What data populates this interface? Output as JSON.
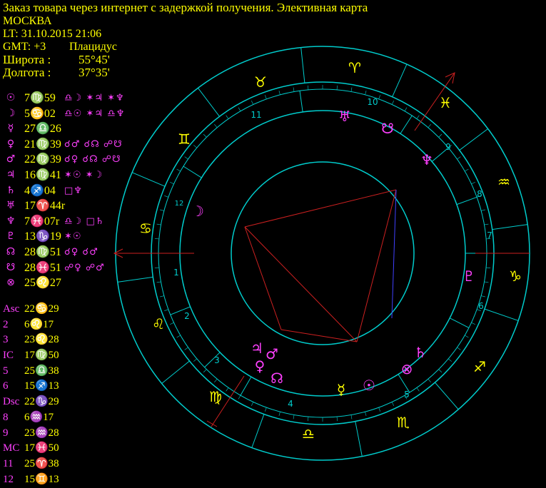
{
  "header": {
    "title": "Заказ товара через интернет с задержкой получения. Элективная карта",
    "city": "МОСКВА",
    "lt": "LT: 31.10.2015  21:06",
    "gmt": "GMT: +3",
    "house_system": "Плацидус",
    "lat_label": "Широта :",
    "lat_value": "55°45'",
    "lon_label": "Долгота :",
    "lon_value": "37°35'"
  },
  "planets": [
    {
      "glyph": "☉",
      "pos": "7♍59",
      "aspects": "♎☽ ✶♃ ✶♆"
    },
    {
      "glyph": "☽",
      "pos": "5♋02",
      "aspects": "♎☉ ✶♃ ♎♆"
    },
    {
      "glyph": "☿",
      "pos": "27♎26",
      "aspects": ""
    },
    {
      "glyph": "♀",
      "pos": "21♍39",
      "aspects": "☌♂ ☌☊ ☍☋"
    },
    {
      "glyph": "♂",
      "pos": "22♍39",
      "aspects": "☌♀ ☌☊ ☍☋"
    },
    {
      "glyph": "♃",
      "pos": "16♍41",
      "aspects": "✶☉ ✶☽"
    },
    {
      "glyph": "♄",
      "pos": "4♐04",
      "aspects": "□♆"
    },
    {
      "glyph": "♅",
      "pos": "17♈44r",
      "aspects": ""
    },
    {
      "glyph": "♆",
      "pos": "7♓07r",
      "aspects": "♎☽ □♄"
    },
    {
      "glyph": "♇",
      "pos": "13♑19",
      "aspects": "✶☉"
    },
    {
      "glyph": "☊",
      "pos": "28♍51",
      "aspects": "☌♀ ☌♂"
    },
    {
      "glyph": "☋",
      "pos": "28♓51",
      "aspects": "☍♀ ☍♂"
    },
    {
      "glyph": "⊗",
      "pos": "25♌27",
      "aspects": ""
    }
  ],
  "cusps": [
    {
      "label": "Asc",
      "pos": "22♋29"
    },
    {
      "label": "2",
      "pos": "6♌17"
    },
    {
      "label": "3",
      "pos": "23♌28"
    },
    {
      "label": "IC",
      "pos": "17♍50"
    },
    {
      "label": "5",
      "pos": "25♎38"
    },
    {
      "label": "6",
      "pos": "15♐13"
    },
    {
      "label": "Dsc",
      "pos": "22♑29"
    },
    {
      "label": "8",
      "pos": "6♒17"
    },
    {
      "label": "9",
      "pos": "23♒28"
    },
    {
      "label": "MC",
      "pos": "17♓50"
    },
    {
      "label": "11",
      "pos": "25♈38"
    },
    {
      "label": "12",
      "pos": "15♊13"
    }
  ],
  "wheel": {
    "house_numbers": [
      {
        "n": "1"
      },
      {
        "n": "2"
      },
      {
        "n": "3"
      },
      {
        "n": "4"
      },
      {
        "n": "5"
      },
      {
        "n": "6"
      },
      {
        "n": "7"
      },
      {
        "n": "8"
      },
      {
        "n": "9"
      },
      {
        "n": "10"
      },
      {
        "n": "11"
      },
      {
        "n": "12"
      }
    ],
    "signs": [
      "♈",
      "♉",
      "♊",
      "♋",
      "♌",
      "♍",
      "♎",
      "♏",
      "♐",
      "♑",
      "♒",
      "♓"
    ],
    "planet_glyphs": [
      "♅",
      "☋",
      "♆",
      "☽",
      "♇",
      "♃",
      "♂",
      "♀",
      "☊",
      "☿",
      "☉",
      "♄",
      "⊗"
    ]
  },
  "colors": {
    "background": "#000000",
    "text_yellow": "#ffff00",
    "magenta": "#ff40ff",
    "cyan": "#00cccc",
    "red": "#cc2020",
    "blue": "#4040ff"
  }
}
